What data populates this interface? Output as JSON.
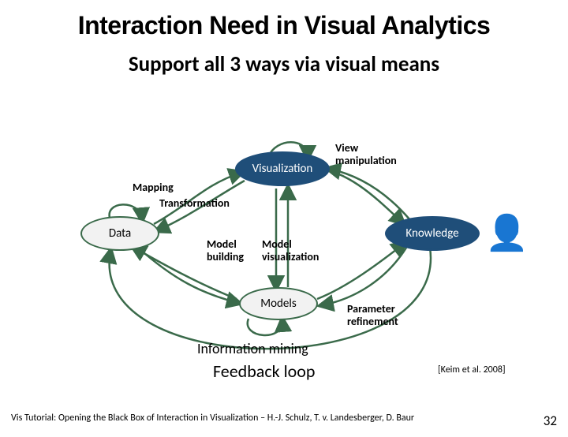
{
  "title": "Interaction Need in Visual Analytics",
  "subtitle": "Support all 3 ways via visual means",
  "nodes": {
    "visualization": "Visualization",
    "data": "Data",
    "models": "Models",
    "knowledge": "Knowledge"
  },
  "labels": {
    "view_manipulation": "View\nmanipulation",
    "mapping": "Mapping",
    "transformation": "Transformation",
    "model_building": "Model\nbuilding",
    "model_visualization": "Model\nvisualization",
    "parameter_refinement": "Parameter\nrefinement",
    "information_mining": "Information mining",
    "feedback_loop": "Feedback loop"
  },
  "citation": "[Keim et al. 2008]",
  "footer_text": "Vis Tutorial: Opening the Black Box of Interaction in Visualization – H.-J. Schulz, T. v. Landesberger, D. Baur",
  "slide_number": "32"
}
